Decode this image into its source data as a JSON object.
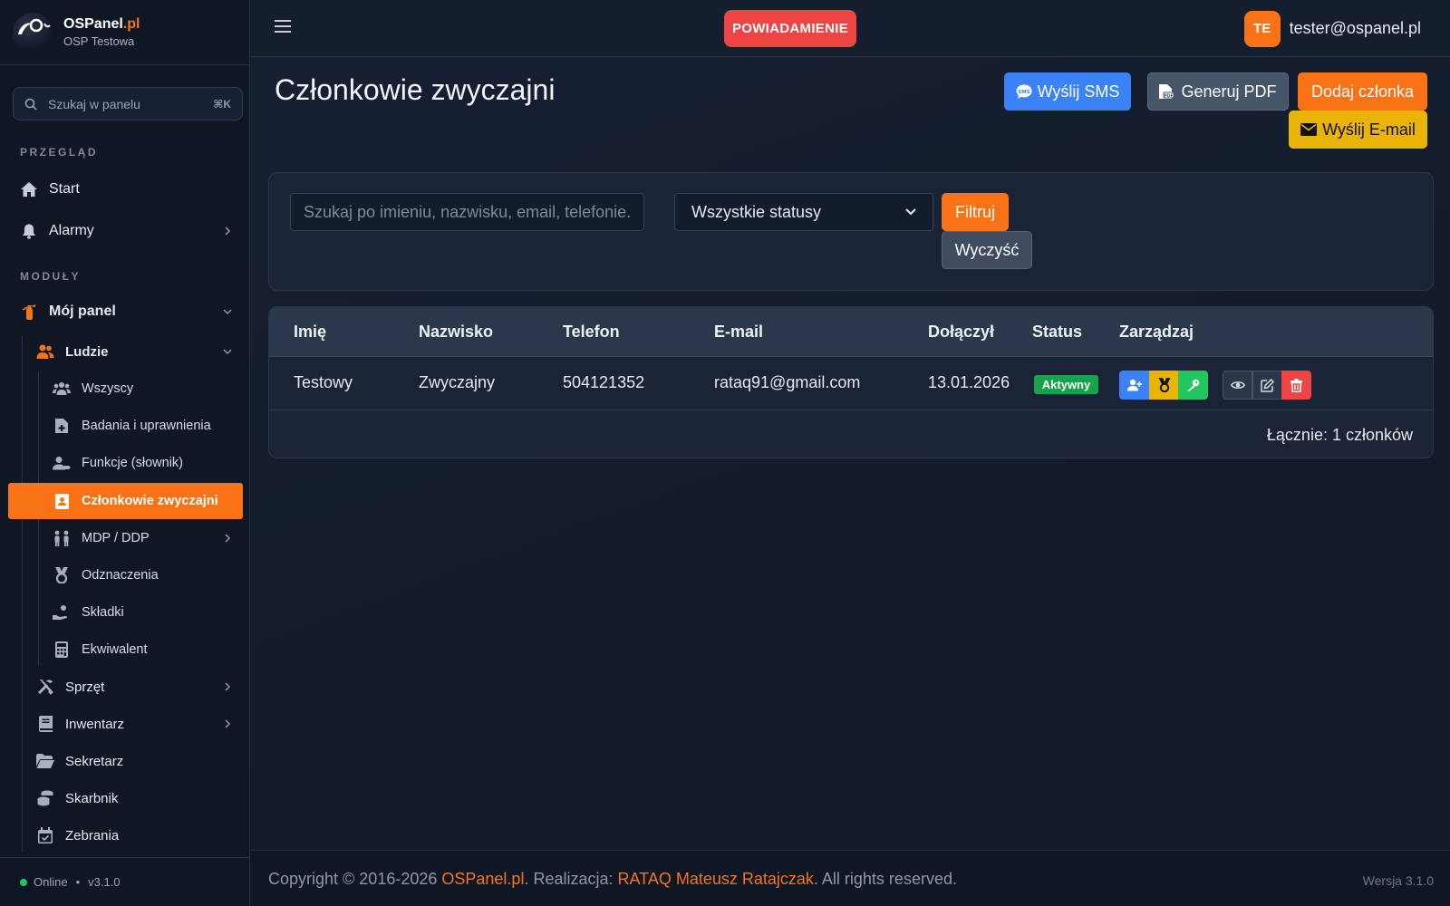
{
  "brand": {
    "name_main": "OSPanel",
    "name_suffix": ".pl",
    "subtitle": "OSP Testowa"
  },
  "sidebar": {
    "search": {
      "placeholder": "Szukaj w panelu",
      "shortcut": "⌘K"
    },
    "section_overview": "PRZEGLĄD",
    "section_modules": "MODUŁY",
    "start": "Start",
    "alarms": "Alarmy",
    "my_panel": "Mój panel",
    "people": "Ludzie",
    "people_items": [
      {
        "label": "Wszyscy",
        "icon": "users-icon"
      },
      {
        "label": "Badania i uprawnienia",
        "icon": "medical-file-icon"
      },
      {
        "label": "Funkcje (słownik)",
        "icon": "user-tag-icon"
      },
      {
        "label": "Członkowie zwyczajni",
        "icon": "id-badge-icon",
        "active": true
      },
      {
        "label": "MDP / DDP",
        "icon": "children-icon"
      },
      {
        "label": "Odznaczenia",
        "icon": "medal-icon"
      },
      {
        "label": "Składki",
        "icon": "hand-coin-icon"
      },
      {
        "label": "Ekwiwalent",
        "icon": "calculator-icon"
      }
    ],
    "modules": [
      {
        "label": "Sprzęt",
        "icon": "tools-icon"
      },
      {
        "label": "Inwentarz",
        "icon": "book-icon"
      },
      {
        "label": "Sekretarz",
        "icon": "folder-icon"
      },
      {
        "label": "Skarbnik",
        "icon": "coins-icon"
      },
      {
        "label": "Zebrania",
        "icon": "calendar-icon"
      }
    ],
    "status": "Online",
    "version": "v3.1.0"
  },
  "topbar": {
    "notification": "POWIADAMIENIE",
    "avatar_initials": "TE",
    "user_email": "tester@ospanel.pl"
  },
  "page": {
    "title": "Członkowie zwyczajni",
    "buttons": {
      "sms": "Wyślij SMS",
      "pdf": "Generuj PDF",
      "add": "Dodaj członka",
      "email": "Wyślij E-mail"
    },
    "filter": {
      "search_placeholder": "Szukaj po imieniu, nazwisku, email, telefonie...",
      "status_selected": "Wszystkie statusy",
      "filter_label": "Filtruj",
      "clear_label": "Wyczyść"
    },
    "table": {
      "columns": [
        "Imię",
        "Nazwisko",
        "Telefon",
        "E-mail",
        "Dołączył",
        "Status",
        "Zarządzaj"
      ],
      "rows": [
        {
          "first_name": "Testowy",
          "last_name": "Zwyczajny",
          "phone": "504121352",
          "email": "rataq91@gmail.com",
          "joined": "13.01.2026",
          "status": "Aktywny"
        }
      ],
      "total": "Łącznie: 1 członków"
    }
  },
  "footer": {
    "copyright_prefix": "Copyright © 2016-2026 ",
    "brand_link": "OSPanel.pl",
    "middle": ". Realizacja: ",
    "author_link": "RATAQ Mateusz Ratajczak",
    "suffix": ". All rights reserved.",
    "version": "Wersja 3.1.0"
  },
  "colors": {
    "accent": "#f97316",
    "danger": "#ef4444",
    "primary": "#3b82f6",
    "warning": "#eab308",
    "success": "#22c55e"
  }
}
